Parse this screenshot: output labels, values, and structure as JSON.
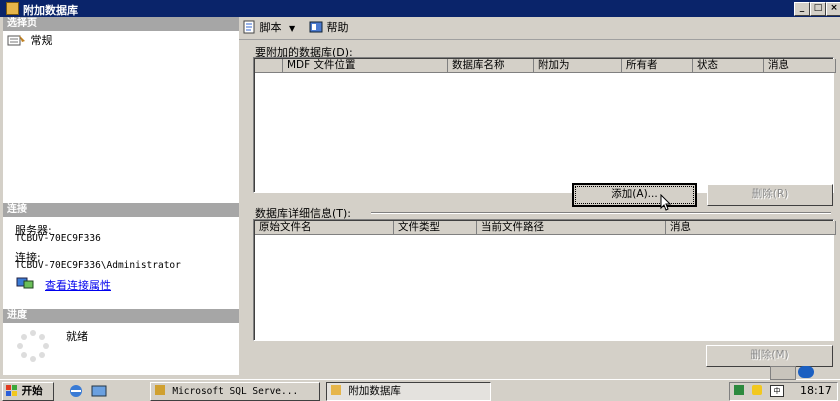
{
  "window": {
    "title": "附加数据库",
    "min": "_",
    "max": "□",
    "close": "×"
  },
  "left": {
    "select_page_header": "选择页",
    "pages": [
      {
        "label": "常规"
      }
    ],
    "connection_header": "连接",
    "server_label": "服务器:",
    "server_value": "TCBUV-70EC9F336",
    "connection_label": "连接:",
    "connection_value": "TCBUV-70EC9F336\\Administrator",
    "view_conn_props": "查看连接属性",
    "progress_header": "进度",
    "progress_status": "就绪"
  },
  "toolbar": {
    "script": "脚本",
    "help": "帮助"
  },
  "attach": {
    "label": "要附加的数据库(D):",
    "columns": [
      "MDF 文件位置",
      "数据库名称",
      "附加为",
      "所有者",
      "状态",
      "消息"
    ],
    "add_button": "添加(A)...",
    "remove_button": "删除(R)"
  },
  "details": {
    "label": "数据库详细信息(T):",
    "columns": [
      "原始文件名",
      "文件类型",
      "当前文件路径",
      "消息"
    ],
    "remove_button": "删除(M)"
  },
  "taskbar": {
    "start": "开始",
    "tasks": [
      {
        "label": "Microsoft SQL Serve..."
      },
      {
        "label": "附加数据库"
      }
    ],
    "clock": "18:17"
  },
  "colors": {
    "title_bg": "#0a246a",
    "section_header": "#a6a6a6",
    "face": "#d4d0c8"
  }
}
